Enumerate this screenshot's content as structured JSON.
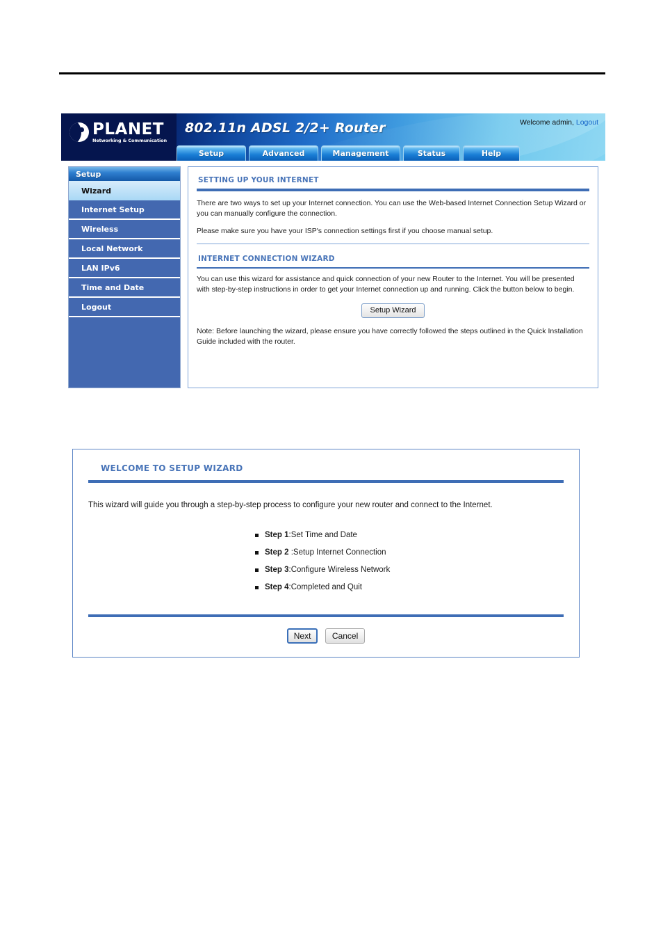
{
  "document": {
    "rule": "horizontal-rule"
  },
  "router_ui": {
    "brand": {
      "name": "PLANET",
      "tagline": "Networking & Communication",
      "logo_icon": "planet-globe-icon"
    },
    "product_title": "802.11n ADSL 2/2+ Router",
    "account": {
      "welcome_text": "Welcome admin,",
      "logout_label": "Logout"
    },
    "tabs": [
      {
        "label": "Setup"
      },
      {
        "label": "Advanced"
      },
      {
        "label": "Management"
      },
      {
        "label": "Status"
      },
      {
        "label": "Help"
      }
    ],
    "sidebar": {
      "header": "Setup",
      "items": [
        {
          "label": "Wizard",
          "active": true
        },
        {
          "label": "Internet Setup",
          "active": false
        },
        {
          "label": "Wireless",
          "active": false
        },
        {
          "label": "Local Network",
          "active": false
        },
        {
          "label": "LAN IPv6",
          "active": false
        },
        {
          "label": "Time and Date",
          "active": false
        },
        {
          "label": "Logout",
          "active": false
        }
      ]
    },
    "content": {
      "section1": {
        "title": "SETTING UP YOUR INTERNET",
        "paragraph1": "There are two ways to set up your Internet connection. You can use the Web-based Internet Connection Setup Wizard or you can manually configure the connection.",
        "paragraph2": "Please make sure you have your ISP's connection settings first if you choose manual setup."
      },
      "section2": {
        "title": "INTERNET CONNECTION WIZARD",
        "paragraph1": "You can use this wizard for assistance and quick connection of your new Router to the Internet. You will be presented with step-by-step instructions in order to get your Internet connection up and running. Click the button below to begin.",
        "button_label": "Setup Wizard",
        "note": "Note: Before launching the wizard, please ensure you have correctly followed the steps outlined in the Quick Installation Guide included with the router."
      }
    }
  },
  "wizard_panel": {
    "title": "WELCOME TO SETUP WIZARD",
    "intro": "This wizard will guide you through a step-by-step process to configure your new router and connect to the Internet.",
    "steps": [
      {
        "label": "Step 1",
        "text": ":Set Time and Date"
      },
      {
        "label": "Step 2",
        "text": " :Setup Internet Connection"
      },
      {
        "label": "Step 3",
        "text": ":Configure Wireless Network"
      },
      {
        "label": "Step 4",
        "text": ":Completed and Quit"
      }
    ],
    "buttons": {
      "next_label": "Next",
      "cancel_label": "Cancel"
    }
  },
  "colors": {
    "sidebar_blue": "#4368b0",
    "heading_blue": "#4874b8",
    "rule_blue": "#3e6db5",
    "link_blue": "#1463c8",
    "masthead_dark": "#05154e",
    "masthead_light": "#84d4f2"
  }
}
